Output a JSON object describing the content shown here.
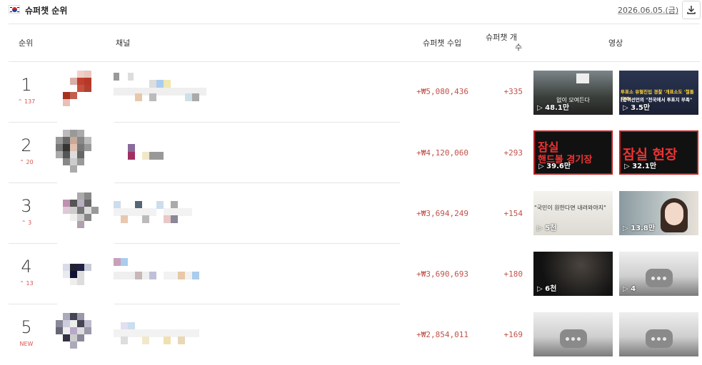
{
  "header": {
    "title": "슈퍼챗 순위",
    "date": "2026.06.05.(금)"
  },
  "columns": {
    "rank": "순위",
    "channel": "채널",
    "income": "슈퍼챗 수입",
    "count_line1": "슈퍼챗 개",
    "count_line2": "수",
    "videos": "영상"
  },
  "rows": [
    {
      "rank": "1",
      "delta": "⌃ 137",
      "income": "+₩5,080,436",
      "count": "+335",
      "videos": [
        {
          "views": "▷ 48.1만",
          "overlay": "없이 모여든다"
        },
        {
          "views": "▷ 3.5만",
          "overlay": "투표소 유혈진입 경찰 '개표소도 '철통차벽'",
          "overlay2": "[충격선언의 \"전국에서 투표지 부족\""
        }
      ]
    },
    {
      "rank": "2",
      "delta": "⌃ 20",
      "income": "+₩4,120,060",
      "count": "+293",
      "videos": [
        {
          "views": "▷ 39.6만",
          "overlay": "잠실",
          "overlay2": "핸드볼 경기장"
        },
        {
          "views": "▷ 32.1만",
          "overlay": "잠실 현장"
        }
      ]
    },
    {
      "rank": "3",
      "delta": "⌃ 3",
      "income": "+₩3,694,249",
      "count": "+154",
      "videos": [
        {
          "views": "▷ 5천",
          "overlay": "\"국민이 원한다면 내려와야지\""
        },
        {
          "views": "▷ 13.8만"
        }
      ]
    },
    {
      "rank": "4",
      "delta": "⌃ 13",
      "income": "+₩3,690,693",
      "count": "+180",
      "videos": [
        {
          "views": "▷ 6천"
        },
        {
          "views": "▷ 4"
        }
      ]
    },
    {
      "rank": "5",
      "delta": "NEW",
      "income": "+₩2,854,011",
      "count": "+169",
      "videos": [
        {
          "views": ""
        },
        {
          "views": ""
        }
      ]
    }
  ],
  "colors": {
    "accent": "#c0524a",
    "delta": "#d9534f"
  }
}
